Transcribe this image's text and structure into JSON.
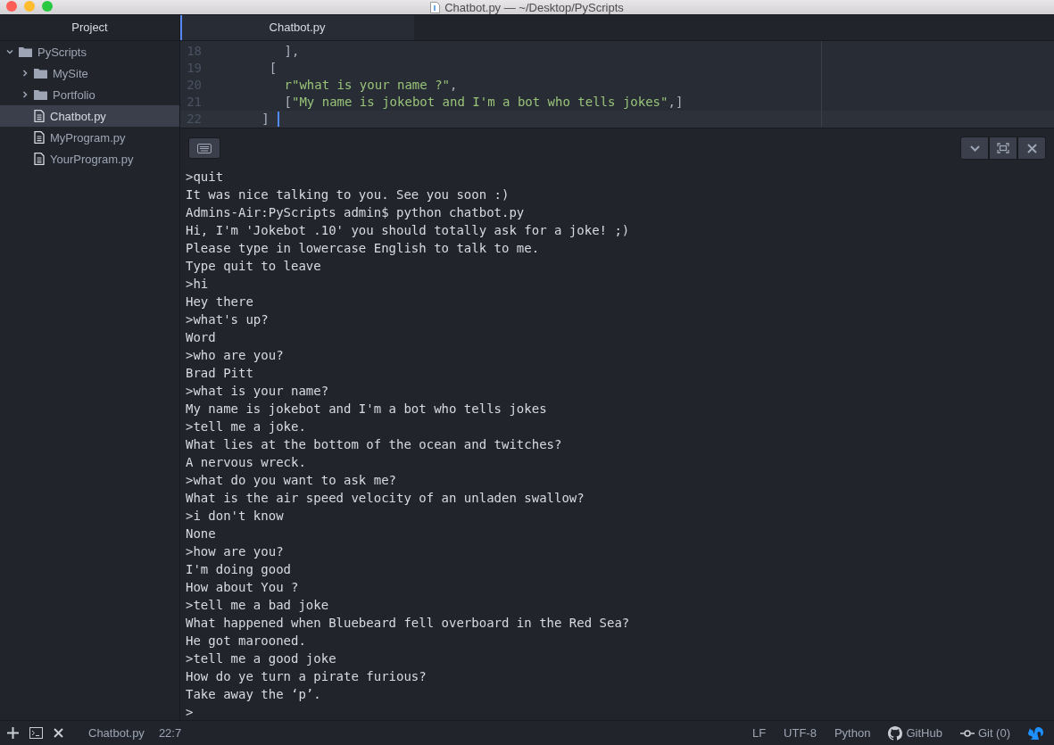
{
  "window": {
    "title": "Chatbot.py — ~/Desktop/PyScripts"
  },
  "sidebar": {
    "title": "Project",
    "tree": [
      {
        "label": "PyScripts",
        "kind": "folder",
        "expanded": true,
        "selected": false,
        "children": [
          {
            "label": "MySite",
            "kind": "folder",
            "expanded": false,
            "selected": false
          },
          {
            "label": "Portfolio",
            "kind": "folder",
            "expanded": false,
            "selected": false
          },
          {
            "label": "Chatbot.py",
            "kind": "file",
            "selected": true
          },
          {
            "label": "MyProgram.py",
            "kind": "file",
            "selected": false
          },
          {
            "label": "YourProgram.py",
            "kind": "file",
            "selected": false
          }
        ]
      }
    ]
  },
  "tabs": [
    {
      "label": "Chatbot.py",
      "selected": true
    }
  ],
  "editor": {
    "lines": [
      {
        "number": "18",
        "segments": [
          {
            "kind": "punct",
            "text": "      ],"
          }
        ]
      },
      {
        "number": "19",
        "segments": [
          {
            "kind": "punct",
            "text": "    ["
          }
        ]
      },
      {
        "number": "20",
        "segments": [
          {
            "kind": "string",
            "text": "      r\"what is your name ?\""
          },
          {
            "kind": "punct",
            "text": ","
          }
        ]
      },
      {
        "number": "21",
        "segments": [
          {
            "kind": "punct",
            "text": "      ["
          },
          {
            "kind": "string",
            "text": "\"My name is jokebot and I'm a bot who tells jokes\""
          },
          {
            "kind": "punct",
            "text": ",]"
          }
        ]
      },
      {
        "number": "22",
        "segments": [
          {
            "kind": "punct",
            "text": "   ]"
          }
        ]
      }
    ]
  },
  "terminal": {
    "lines": [
      ">quit",
      "It was nice talking to you. See you soon :)",
      "Admins-Air:PyScripts admin$ python chatbot.py",
      "Hi, I'm 'Jokebot .10' you should totally ask for a joke! ;)",
      "Please type in lowercase English to talk to me.",
      "Type quit to leave",
      ">hi",
      "Hey there",
      ">what's up?",
      "Word",
      ">who are you?",
      "Brad Pitt",
      ">what is your name?",
      "My name is jokebot and I'm a bot who tells jokes",
      ">tell me a joke.",
      "What lies at the bottom of the ocean and twitches?",
      "A nervous wreck.",
      ">what do you want to ask me?",
      "What is the air speed velocity of an unladen swallow?",
      ">i don't know",
      "None",
      ">how are you?",
      "I'm doing good",
      "How about You ?",
      ">tell me a bad joke",
      "What happened when Bluebeard fell overboard in the Red Sea?",
      "He got marooned.",
      ">tell me a good joke",
      "How do ye turn a pirate furious?",
      "Take away the ‘p’.",
      ">"
    ]
  },
  "status_bar": {
    "file": "Chatbot.py",
    "cursor": "22:7",
    "line_ending": "LF",
    "encoding": "UTF-8",
    "grammar": "Python",
    "github": "GitHub",
    "git": "Git (0)"
  }
}
